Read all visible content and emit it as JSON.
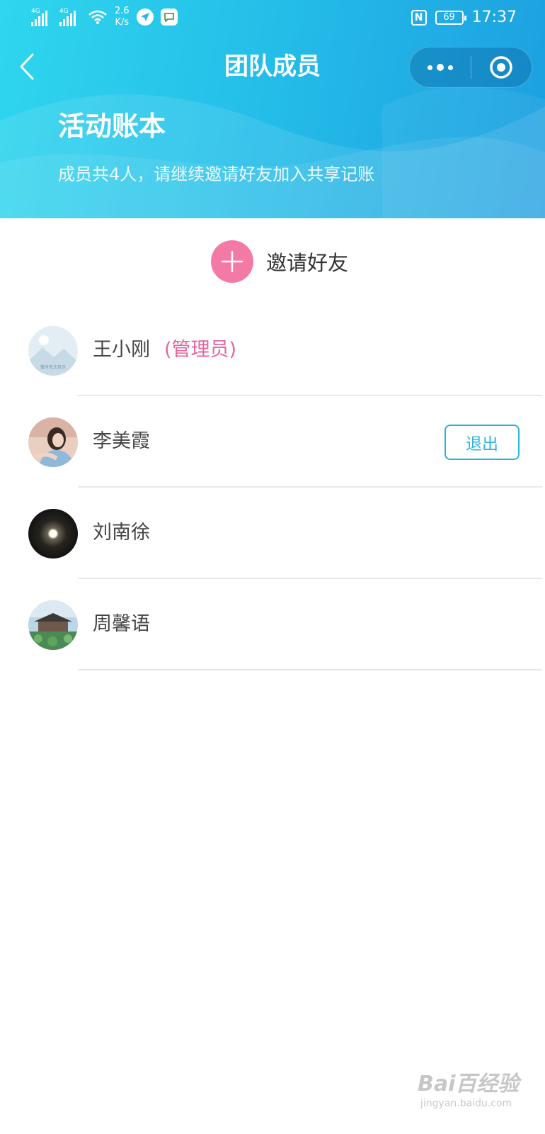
{
  "status_bar": {
    "network1": "4G",
    "network2": "4G",
    "speed_value": "2.6",
    "speed_unit": "K/s",
    "nfc": "N",
    "battery": "69",
    "time": "17:37"
  },
  "nav": {
    "title": "团队成员",
    "back_icon": "chevron-left-icon",
    "more_icon": "more-dots-icon",
    "close_icon": "target-circle-icon"
  },
  "header": {
    "book_title": "活动账本",
    "subtitle": "成员共4人，请继续邀请好友加入共享记账"
  },
  "invite": {
    "label": "邀请好友",
    "icon": "plus-icon"
  },
  "members": [
    {
      "name": "王小刚",
      "role": "(管理员)",
      "avatar_text": "暂时无法显示"
    },
    {
      "name": "李美霞",
      "action": "退出"
    },
    {
      "name": "刘南徐"
    },
    {
      "name": "周馨语"
    }
  ],
  "watermark": {
    "main": "Bai百经验",
    "sub": "jingyan.baidu.com"
  },
  "colors": {
    "header_start": "#2fd6ee",
    "header_end": "#1c9fe0",
    "accent_pink": "#f47aa6",
    "admin_pink": "#e6649f",
    "button_blue": "#2bb3df"
  }
}
